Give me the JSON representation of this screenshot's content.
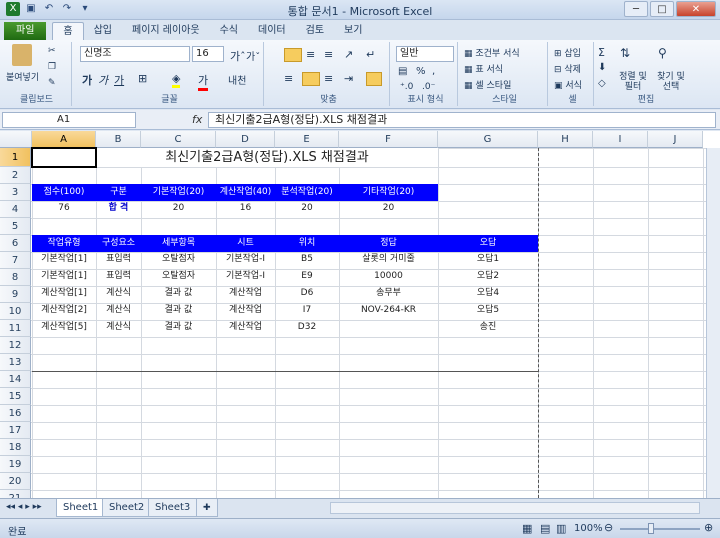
{
  "window": {
    "title": "통합 문서1 - Microsoft Excel"
  },
  "tabs": [
    "파일",
    "홈",
    "삽입",
    "페이지 레이아웃",
    "수식",
    "데이터",
    "검토",
    "보기"
  ],
  "active_tab": "홈",
  "ribbon": {
    "clipboard": {
      "label": "클립보드",
      "paste": "붙여넣기"
    },
    "font": {
      "label": "글꼴",
      "font_name": "신명조",
      "font_size": "16"
    },
    "alignment": {
      "label": "맞춤"
    },
    "number": {
      "label": "표시 형식",
      "format": "일반"
    },
    "styles": {
      "label": "스타일",
      "conditional": "조건부 서식",
      "table": "표 서식",
      "cell": "셀 스타일"
    },
    "cells": {
      "label": "셀",
      "insert": "삽입",
      "delete": "삭제",
      "format": "서식"
    },
    "editing": {
      "label": "편집",
      "sort": "정렬 및 필터",
      "find": "찾기 및 선택"
    }
  },
  "formula_bar": {
    "name_box": "A1",
    "fx": "fx",
    "content": "최신기출2급A형(정답).XLS 채점결과"
  },
  "columns": [
    "A",
    "B",
    "C",
    "D",
    "E",
    "F",
    "G",
    "H",
    "I",
    "J"
  ],
  "rows": [
    "1",
    "2",
    "3",
    "4",
    "5",
    "6",
    "7",
    "8",
    "9",
    "10",
    "11",
    "12",
    "13",
    "14",
    "15",
    "16",
    "17",
    "18",
    "19",
    "20",
    "21"
  ],
  "sheet": {
    "title": "최신기출2급A형(정답).XLS 채점결과",
    "summary_headers": [
      "점수(100)",
      "구분",
      "기본작업(20)",
      "계산작업(40)",
      "분석작업(20)",
      "기타작업(20)"
    ],
    "summary_values": [
      "76",
      "합 격",
      "20",
      "16",
      "20",
      "20"
    ],
    "detail_headers": [
      "작업유형",
      "구성요소",
      "세부항목",
      "시트",
      "위치",
      "정답",
      "오답"
    ],
    "detail_rows": [
      [
        "기본작업[1]",
        "표입력",
        "오탈점자",
        "기본작업-I",
        "B5",
        "살롯의 거미줄",
        "오답1"
      ],
      [
        "기본작업[1]",
        "표입력",
        "오탈점자",
        "기본작업-I",
        "E9",
        "10000",
        "오답2"
      ],
      [
        "계산작업[1]",
        "계산식",
        "결과 값",
        "계산작업",
        "D6",
        "송무부",
        "오답4"
      ],
      [
        "계산작업[2]",
        "계산식",
        "결과 값",
        "계산작업",
        "I7",
        "NOV-264-KR",
        "오답5"
      ],
      [
        "계산작업[5]",
        "계산식",
        "결과 값",
        "계산작업",
        "D32",
        "",
        "송진"
      ]
    ]
  },
  "sheet_tabs": [
    "Sheet1",
    "Sheet2",
    "Sheet3"
  ],
  "status": {
    "mode": "완료",
    "zoom": "100%"
  },
  "colors": {
    "header_fill": "#0000ff",
    "pass_text": "#0000cc"
  }
}
